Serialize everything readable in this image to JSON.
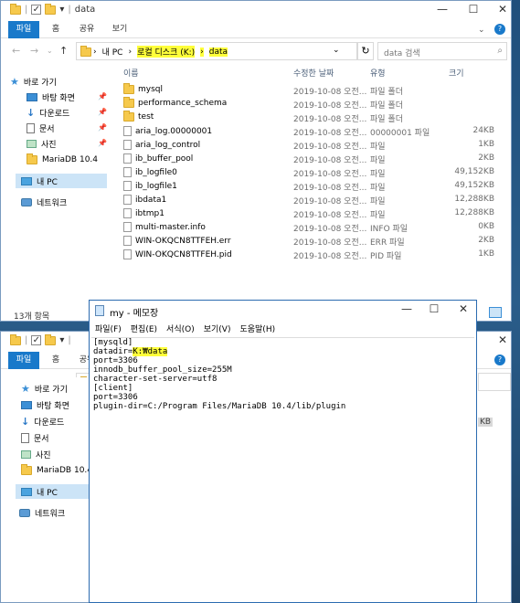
{
  "window1": {
    "title": "data",
    "tabs": [
      "파일",
      "홈",
      "공유",
      "보기"
    ],
    "breadcrumbs": [
      "내 PC",
      "로컬 디스크 (K:)",
      "data"
    ],
    "search_placeholder": "data 검색",
    "columns": [
      "이름",
      "수정한 날짜",
      "유형",
      "크기"
    ],
    "sidebar": [
      {
        "label": "바로 가기",
        "icon": "star-icon"
      },
      {
        "label": "바탕 화면",
        "icon": "desktop-icon"
      },
      {
        "label": "다운로드",
        "icon": "download-icon"
      },
      {
        "label": "문서",
        "icon": "document-icon"
      },
      {
        "label": "사진",
        "icon": "picture-icon"
      },
      {
        "label": "MariaDB 10.4",
        "icon": "folder-icon"
      },
      {
        "label": "내 PC",
        "icon": "pc-icon"
      },
      {
        "label": "네트워크",
        "icon": "network-icon"
      }
    ],
    "files": [
      {
        "name": "mysql",
        "date": "2019-10-08 오전...",
        "type": "파일 폴더",
        "size": "",
        "folder": true
      },
      {
        "name": "performance_schema",
        "date": "2019-10-08 오전...",
        "type": "파일 폴더",
        "size": "",
        "folder": true
      },
      {
        "name": "test",
        "date": "2019-10-08 오전...",
        "type": "파일 폴더",
        "size": "",
        "folder": true
      },
      {
        "name": "aria_log.00000001",
        "date": "2019-10-08 오전...",
        "type": "00000001 파일",
        "size": "24KB",
        "folder": false
      },
      {
        "name": "aria_log_control",
        "date": "2019-10-08 오전...",
        "type": "파일",
        "size": "1KB",
        "folder": false
      },
      {
        "name": "ib_buffer_pool",
        "date": "2019-10-08 오전...",
        "type": "파일",
        "size": "2KB",
        "folder": false
      },
      {
        "name": "ib_logfile0",
        "date": "2019-10-08 오전...",
        "type": "파일",
        "size": "49,152KB",
        "folder": false
      },
      {
        "name": "ib_logfile1",
        "date": "2019-10-08 오전...",
        "type": "파일",
        "size": "49,152KB",
        "folder": false
      },
      {
        "name": "ibdata1",
        "date": "2019-10-08 오전...",
        "type": "파일",
        "size": "12,288KB",
        "folder": false
      },
      {
        "name": "ibtmp1",
        "date": "2019-10-08 오전...",
        "type": "파일",
        "size": "12,288KB",
        "folder": false
      },
      {
        "name": "multi-master.info",
        "date": "2019-10-08 오전...",
        "type": "INFO 파일",
        "size": "0KB",
        "folder": false
      },
      {
        "name": "WIN-OKQCN8TTFEH.err",
        "date": "2019-10-08 오전...",
        "type": "ERR 파일",
        "size": "2KB",
        "folder": false
      },
      {
        "name": "WIN-OKQCN8TTFEH.pid",
        "date": "2019-10-08 오전...",
        "type": "PID 파일",
        "size": "1KB",
        "folder": false
      }
    ],
    "status": "13개 항목"
  },
  "window2": {
    "tabs": [
      "파일",
      "홈",
      "공유"
    ],
    "partial_size": "KB"
  },
  "notepad": {
    "title": "my - 메모장",
    "menu": [
      "파일(F)",
      "편집(E)",
      "서식(O)",
      "보기(V)",
      "도움말(H)"
    ],
    "lines": [
      "[mysqld]",
      "datadir=",
      "port=3306",
      "innodb_buffer_pool_size=255M",
      "character-set-server=utf8",
      "[client]",
      "port=3306",
      "plugin-dir=C:/Program Files/MariaDB 10.4/lib/plugin"
    ],
    "datadir_value": "K:₩data"
  },
  "colors": {
    "accent": "#1979ca",
    "highlight": "#ffff3a",
    "selection": "#cce4f7"
  }
}
